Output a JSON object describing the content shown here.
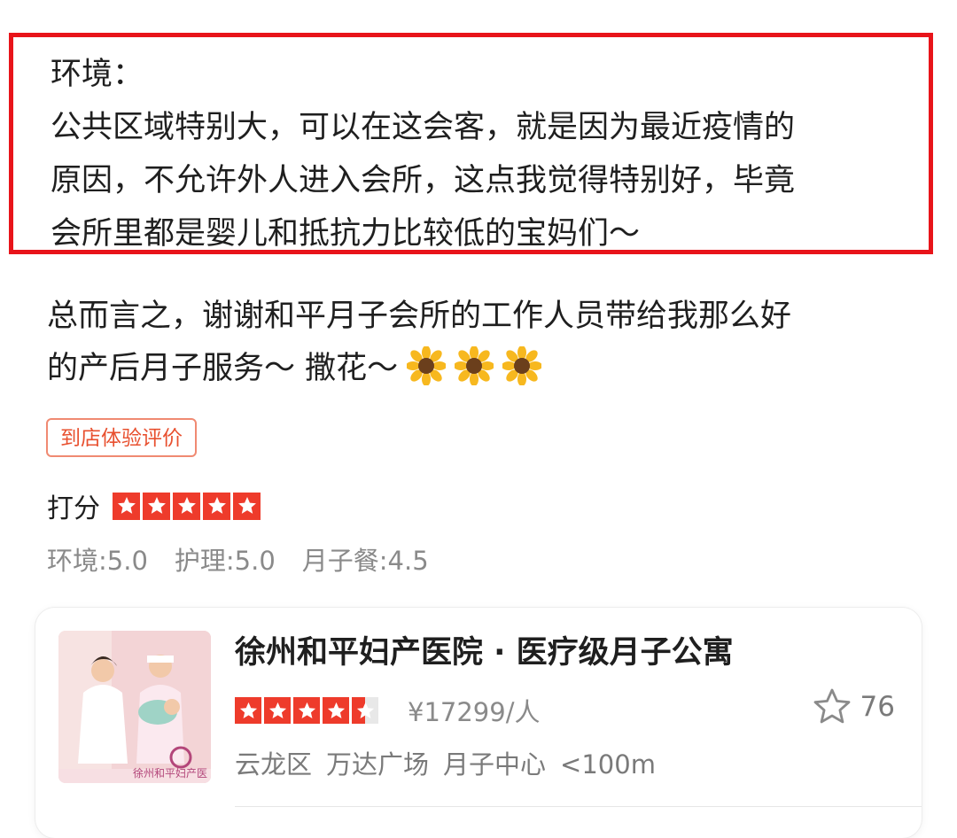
{
  "highlight": {
    "lines": [
      "环境：",
      "公共区域特别大，可以在这会客，就是因为最近疫情的",
      "原因，不允许外人进入会所，这点我觉得特别好，毕竟",
      "会所里都是婴儿和抵抗力比较低的宝妈们～"
    ]
  },
  "summary": {
    "line1": "总而言之，谢谢和平月子会所的工作人员带给我那么好",
    "line2": "的产后月子服务～ 撒花～"
  },
  "badge": {
    "label": "到店体验评价"
  },
  "rating": {
    "label": "打分",
    "stars": 5,
    "sub_scores": [
      "环境:5.0",
      "护理:5.0",
      "月子餐:4.5"
    ]
  },
  "business": {
    "name": "徐州和平妇产医院 · 医疗级月子公寓",
    "stars": 4.5,
    "price": "¥17299/人",
    "favorites": "76",
    "district": "云龙区",
    "area": "万达广场",
    "category": "月子中心",
    "distance": "<100m",
    "thumb_watermark": "徐州和平妇产医"
  },
  "colors": {
    "highlight_border": "#e8141a",
    "star_red": "#ee3b2b",
    "badge_text": "#e8502f"
  },
  "icons": [
    "sunflower-icon",
    "star-icon",
    "favorite-star-icon"
  ]
}
